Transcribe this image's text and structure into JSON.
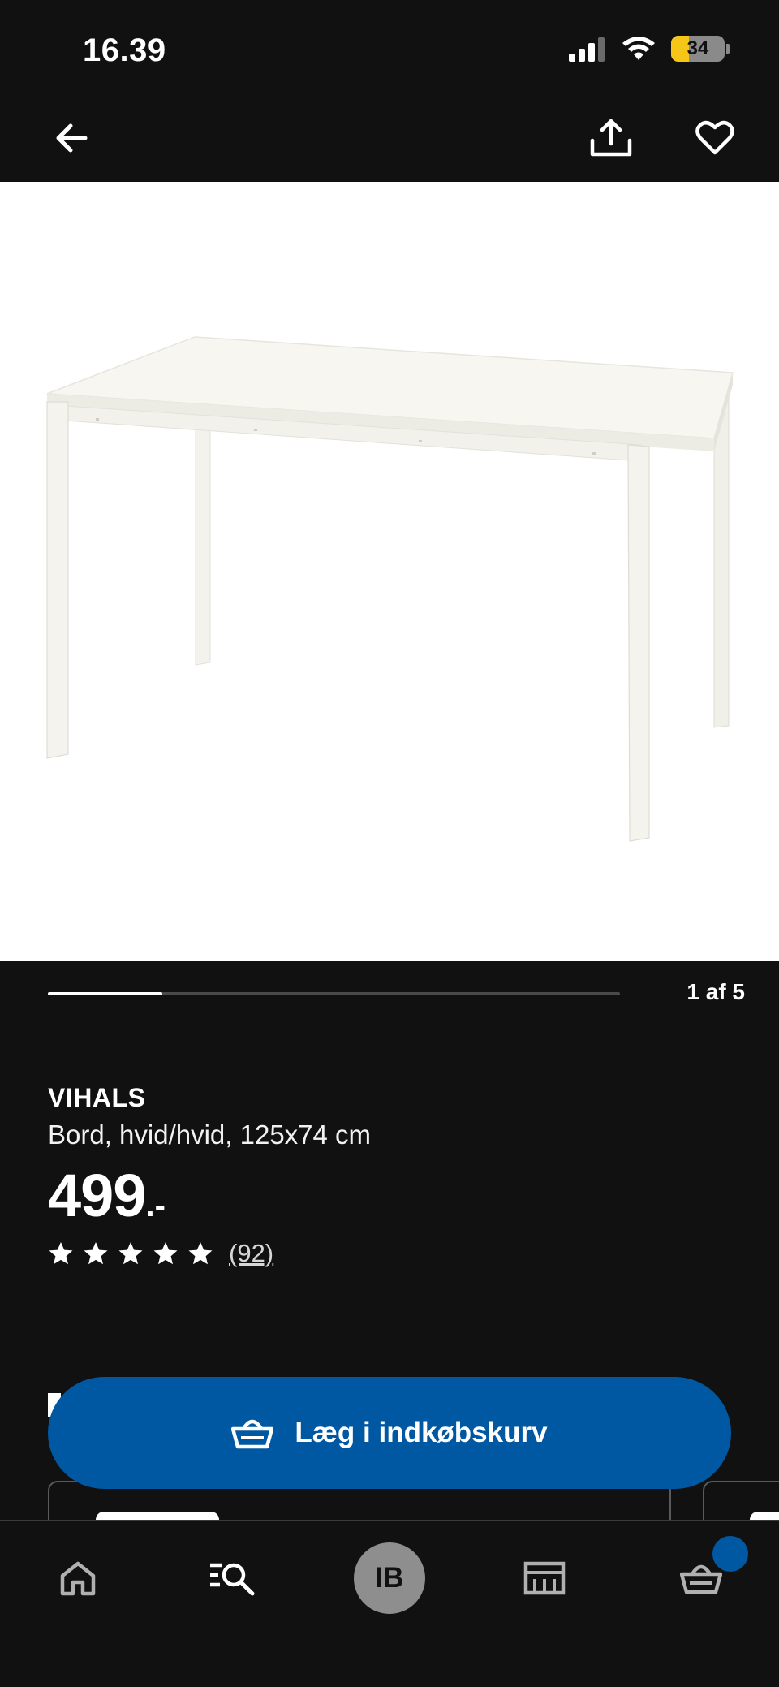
{
  "status_bar": {
    "time": "16.39",
    "battery_level": "34",
    "battery_fraction": 0.34,
    "battery_color": "#f5c518",
    "icons": [
      "signal-icon",
      "wifi-icon",
      "battery-icon"
    ]
  },
  "top_nav": {
    "icons": [
      "back-arrow-icon",
      "share-icon",
      "heart-icon"
    ]
  },
  "gallery": {
    "image_description_icon": "table-product-image",
    "counter": "1 af 5",
    "current": 1,
    "total": 5
  },
  "product": {
    "name": "VIHALS",
    "description": "Bord, hvid/hvid, 125x74 cm",
    "price": "499",
    "price_suffix": ".-",
    "rating_stars": 5,
    "review_count": "(92)"
  },
  "cta": {
    "label": "Læg i indkøbskurv",
    "icon": "basket-icon",
    "color": "#0058a3"
  },
  "tab_bar": {
    "items": [
      {
        "name": "home",
        "icon": "home-icon"
      },
      {
        "name": "search",
        "icon": "search-list-icon"
      },
      {
        "name": "profile",
        "icon": "avatar",
        "initials": "IB"
      },
      {
        "name": "store",
        "icon": "store-icon"
      },
      {
        "name": "cart",
        "icon": "basket-icon"
      }
    ],
    "badge_color": "#0058a3"
  }
}
